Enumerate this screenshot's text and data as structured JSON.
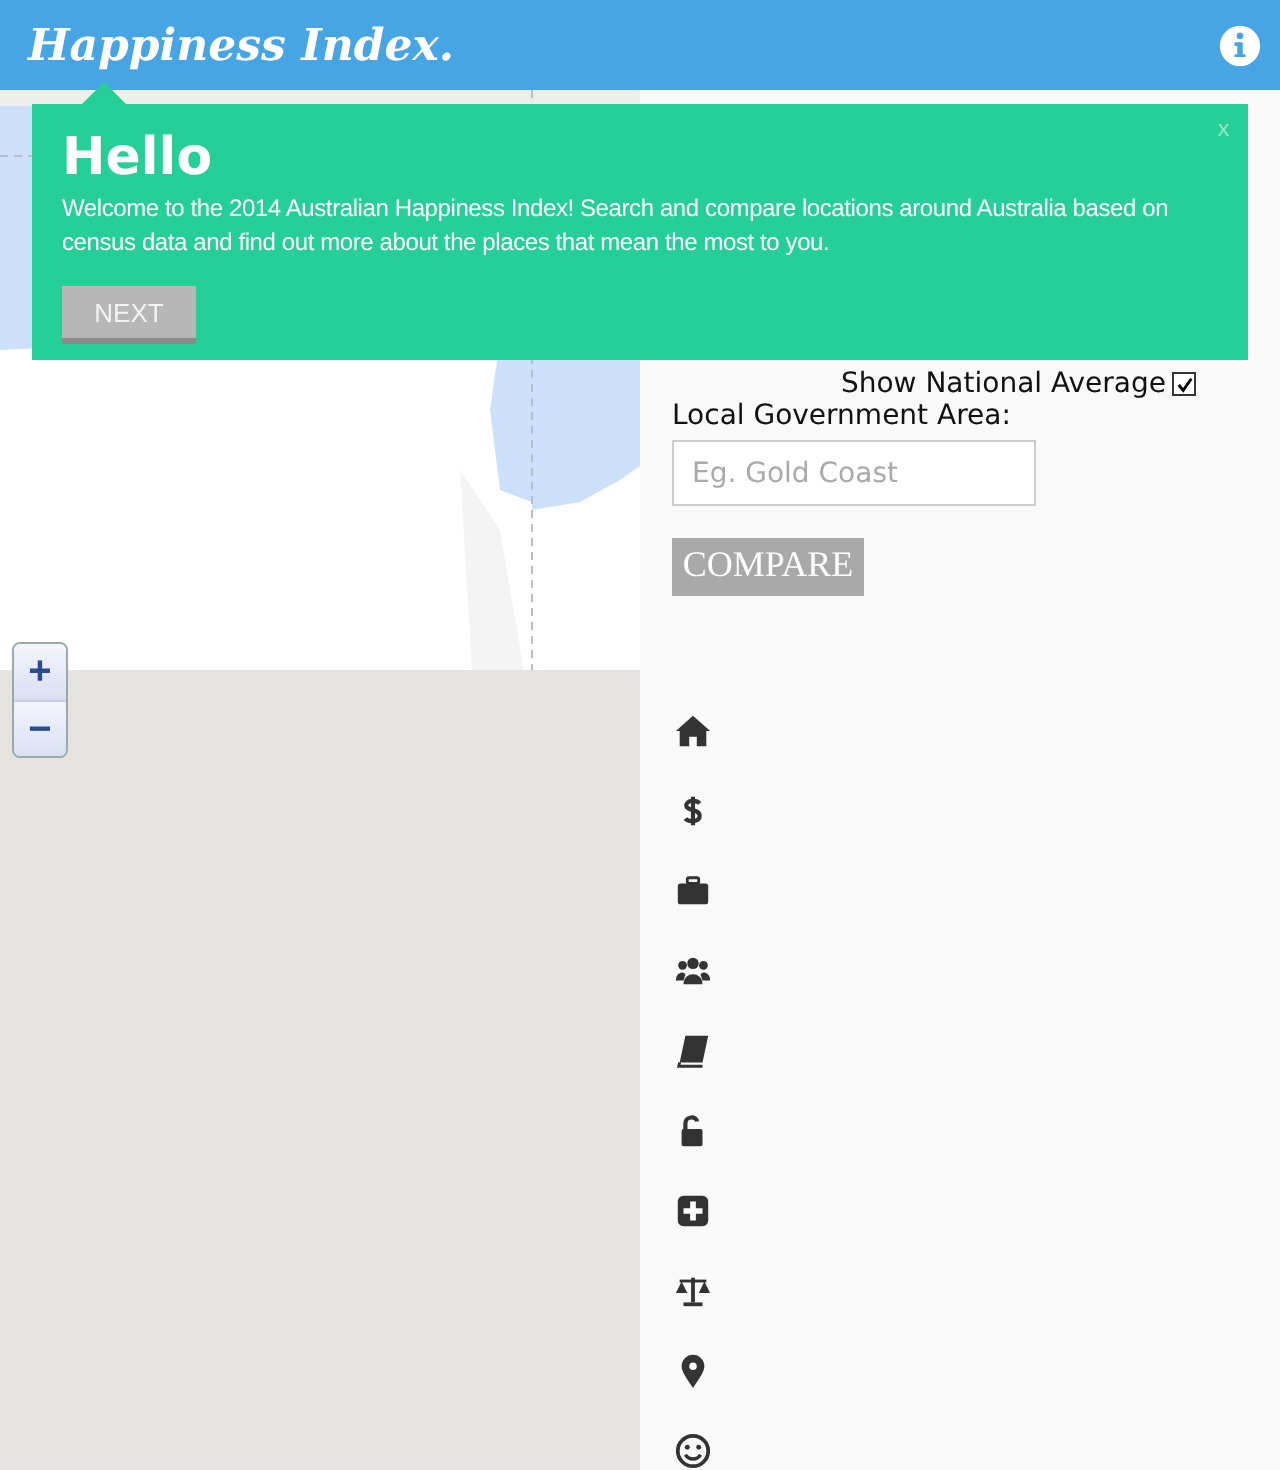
{
  "header": {
    "logo": "Happiness Index."
  },
  "map": {
    "kind": "picture",
    "zoom_in": "+",
    "zoom_out": "−"
  },
  "popup": {
    "title": "Hello",
    "text": "Welcome to the 2014 Australian Happiness Index! Search and compare locations around Australia based on census data and find out more about the places that mean the most to you.",
    "close": "x",
    "button": "NEXT"
  },
  "panel": {
    "national_average": {
      "label": "Show National Average",
      "checked": true
    },
    "lga_label": "Local Government Area:",
    "search": {
      "placeholder": "Eg. Gold Coast"
    },
    "compare": "COMPARE",
    "categories": [
      {
        "kind": "home"
      },
      {
        "kind": "dollar"
      },
      {
        "kind": "briefcase"
      },
      {
        "kind": "group"
      },
      {
        "kind": "book"
      },
      {
        "kind": "unlock"
      },
      {
        "kind": "plus"
      },
      {
        "kind": "scale"
      },
      {
        "kind": "pin"
      },
      {
        "kind": "smile"
      }
    ]
  }
}
